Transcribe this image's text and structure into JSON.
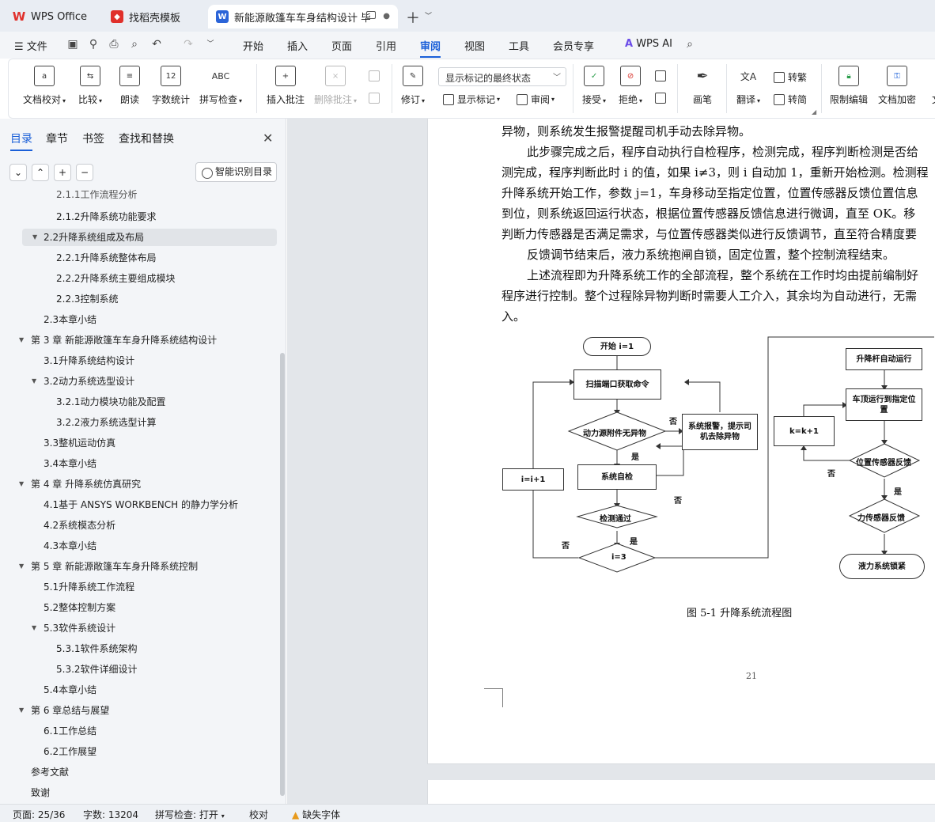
{
  "tabs": {
    "wps": "WPS Office",
    "template": "找稻壳模板",
    "doc": "新能源敞篷车车身结构设计 毕"
  },
  "menu": {
    "file": "文件",
    "items": [
      "开始",
      "插入",
      "页面",
      "引用",
      "审阅",
      "视图",
      "工具",
      "会员专享"
    ],
    "ai": "WPS AI"
  },
  "ribbon": {
    "doc_check": "文档校对",
    "compare": "比较",
    "read": "朗读",
    "word_count": "字数统计",
    "spell": "拼写检查",
    "insert_comment": "插入批注",
    "delete_comment": "删除批注",
    "revise": "修订",
    "markup_state": "显示标记的最终状态",
    "show_markup": "显示标记",
    "review": "审阅",
    "accept": "接受",
    "reject": "拒绝",
    "pen": "画笔",
    "translate": "翻译",
    "to_traditional": "转繁",
    "to_simplified": "转简",
    "restrict": "限制编辑",
    "encrypt": "文档加密",
    "more": "文"
  },
  "panel": {
    "tabs": [
      "目录",
      "章节",
      "书签",
      "查找和替换"
    ],
    "smart": "智能识别目录"
  },
  "toc": [
    "2.1.1工作流程分析",
    "2.1.2升降系统功能要求",
    "2.2升降系统组成及布局",
    "2.2.1升降系统整体布局",
    "2.2.2升降系统主要组成模块",
    "2.2.3控制系统",
    "2.3本章小结",
    "第 3 章 新能源敞篷车车身升降系统结构设计",
    "3.1升降系统结构设计",
    "3.2动力系统选型设计",
    "3.2.1动力模块功能及配置",
    "3.2.2液力系统选型计算",
    "3.3整机运动仿真",
    "3.4本章小结",
    "第 4 章 升降系统仿真研究",
    "4.1基于 ANSYS WORKBENCH 的静力学分析",
    "4.2系统模态分析",
    "4.3本章小结",
    "第 5 章 新能源敞篷车车身升降系统控制",
    "5.1升降系统工作流程",
    "5.2整体控制方案",
    "5.3软件系统设计",
    "5.3.1软件系统架构",
    "5.3.2软件详细设计",
    "5.4本章小结",
    "第 6 章总结与展望",
    "6.1工作总结",
    "6.2工作展望",
    "参考文献",
    "致谢"
  ],
  "doc": {
    "lines": [
      "异物，则系统发生报警提醒司机手动去除异物。",
      "此步骤完成之后，程序自动执行自检程序，检测完成，程序判断检测是否给",
      "测完成，程序判断此时 i 的值，如果 i≠3，则 i 自动加 1，重新开始检测。检测程",
      "升降系统开始工作，参数 j=1，车身移动至指定位置，位置传感器反馈位置信息",
      "到位，则系统返回运行状态，根据位置传感器反馈信息进行微调，直至 OK。移",
      "判断力传感器是否满足需求，与位置传感器类似进行反馈调节，直至符合精度要",
      "反馈调节结束后，液力系统抱闸自锁，固定位置，整个控制流程结束。",
      "上述流程即为升降系统工作的全部流程，整个系统在工作时均由提前编制好",
      "程序进行控制。整个过程除异物判断时需要人工介入，其余均为自动进行，无需",
      "入。"
    ],
    "flow": {
      "start": "开始 i=1",
      "scan": "扫描端口获取命令",
      "check_foreign": "动力源附件无异物",
      "alarm": "系统报警，提示司机去除异物",
      "self_check": "系统自检",
      "pass": "检测通过",
      "i3": "i=3",
      "inc_i": "i=i+1",
      "lift": "升降杆自动运行",
      "move": "车顶运行到指定位置",
      "k": "k=k+1",
      "pos": "位置传感器反馈",
      "force": "力传感器反馈",
      "lock": "液力系统锁紧",
      "yes": "是",
      "no": "否"
    },
    "caption": "图 5-1 升降系统流程图",
    "page_num": "21"
  },
  "status": {
    "page": "页面: 25/36",
    "words": "字数: 13204",
    "spell": "拼写检查: 打开",
    "proof": "校对",
    "missing_font": "缺失字体"
  }
}
